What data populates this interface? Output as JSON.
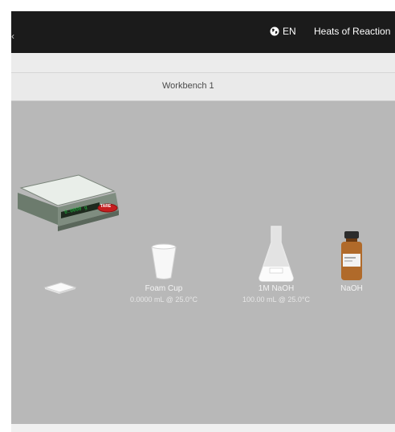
{
  "header": {
    "language": "EN",
    "app_title": "Heats of Reaction",
    "left_edge_glyph": "‹"
  },
  "tabs": [
    {
      "label": "Workbench 1",
      "active": true
    }
  ],
  "scale": {
    "display": "0.0000 g",
    "tare_label": "TARE"
  },
  "items": [
    {
      "id": "foam-cup",
      "name": "Foam Cup",
      "detail": "0.0000 mL @ 25.0°C"
    },
    {
      "id": "naoh-solution",
      "name": "1M NaOH",
      "detail": "100.00 mL @ 25.0°C"
    },
    {
      "id": "naoh-solid",
      "name": "NaOH",
      "detail": ""
    }
  ],
  "colors": {
    "topbar": "#1b1b1b",
    "bench": "#b8b8b8",
    "scale_body": "#6f7d70",
    "tare": "#c41e1e",
    "display": "#20c040",
    "bottle": "#b06a2a"
  }
}
